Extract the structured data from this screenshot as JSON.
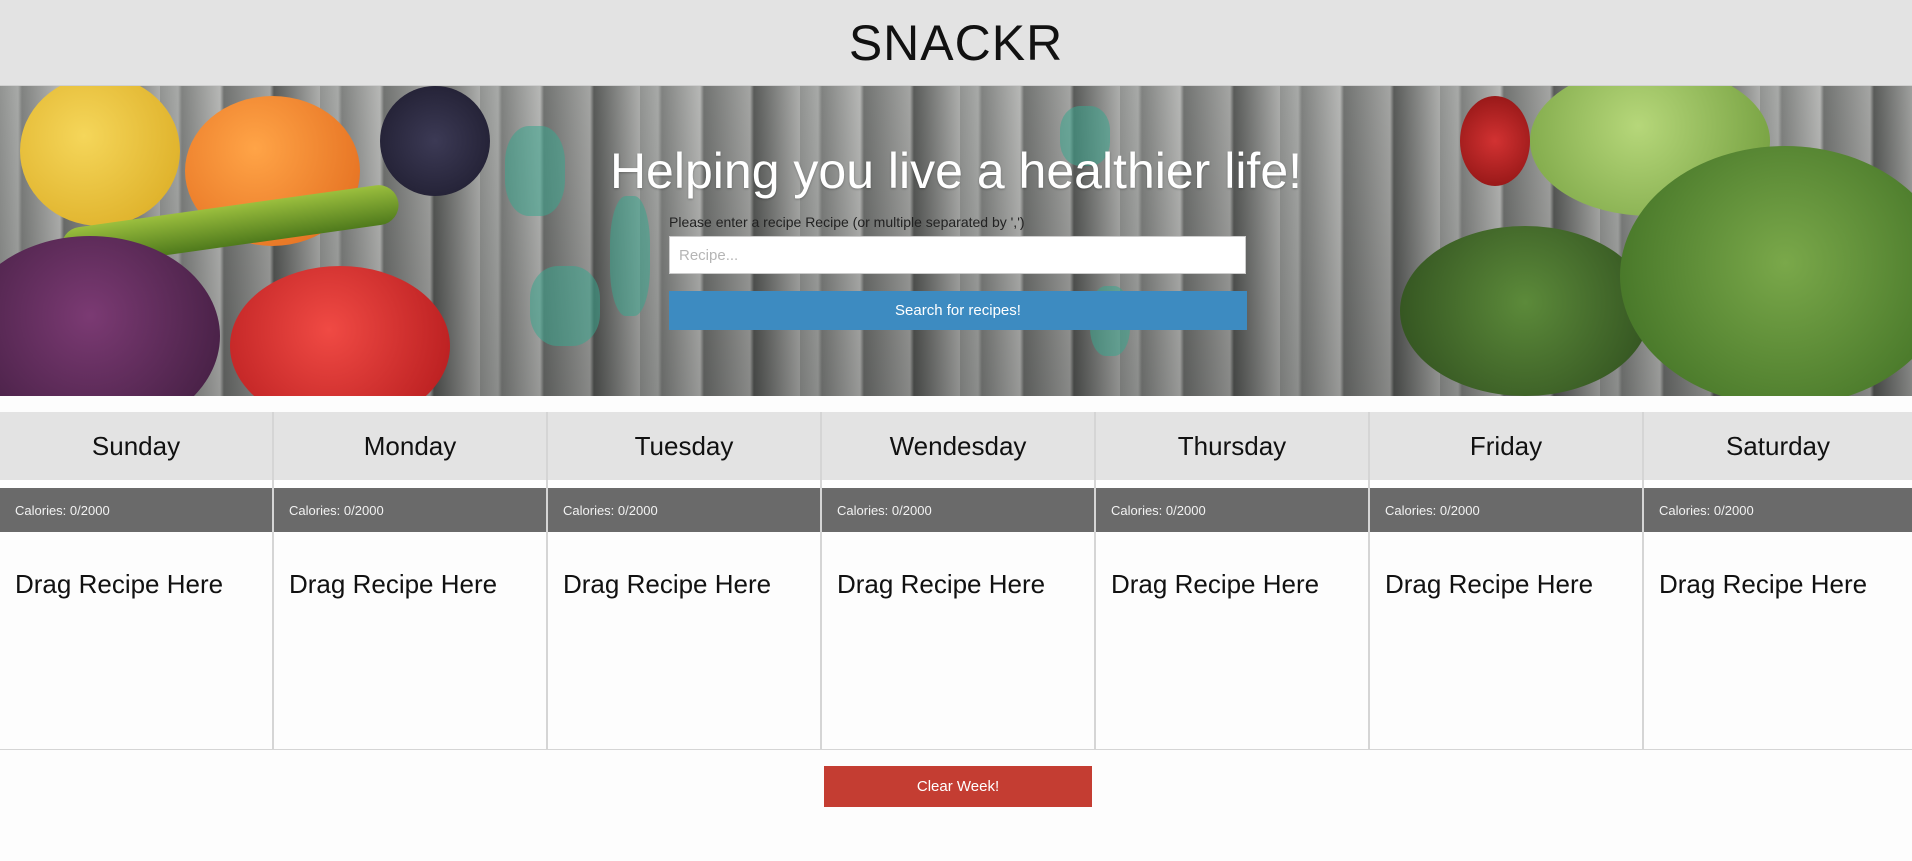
{
  "header": {
    "brand": "SNACKR"
  },
  "hero": {
    "title": "Helping you live a healthier life!",
    "label": "Please enter a recipe Recipe (or multiple separated by ',')",
    "search_placeholder": "Recipe...",
    "search_value": "",
    "search_button": "Search for recipes!"
  },
  "week": {
    "days": [
      {
        "name": "Sunday",
        "calories": "Calories: 0/2000",
        "drop": "Drag Recipe Here"
      },
      {
        "name": "Monday",
        "calories": "Calories: 0/2000",
        "drop": "Drag Recipe Here"
      },
      {
        "name": "Tuesday",
        "calories": "Calories: 0/2000",
        "drop": "Drag Recipe Here"
      },
      {
        "name": "Wendesday",
        "calories": "Calories: 0/2000",
        "drop": "Drag Recipe Here"
      },
      {
        "name": "Thursday",
        "calories": "Calories: 0/2000",
        "drop": "Drag Recipe Here"
      },
      {
        "name": "Friday",
        "calories": "Calories: 0/2000",
        "drop": "Drag Recipe Here"
      },
      {
        "name": "Saturday",
        "calories": "Calories: 0/2000",
        "drop": "Drag Recipe Here"
      }
    ],
    "clear_button": "Clear Week!"
  },
  "colors": {
    "header_bg": "#e3e3e3",
    "search_button": "#3d8bc1",
    "calorie_bar": "#6a6a6a",
    "clear_button": "#c43d32"
  }
}
